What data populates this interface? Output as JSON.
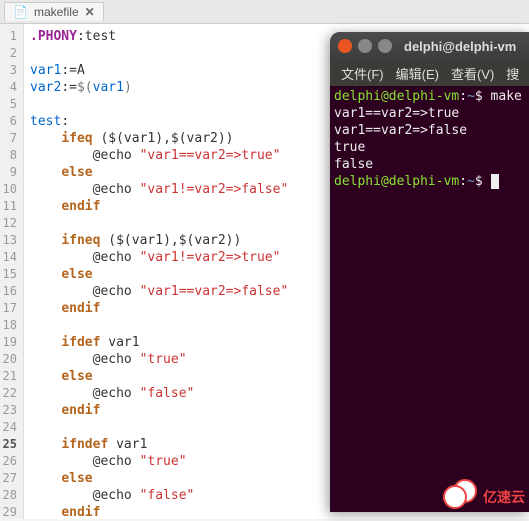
{
  "editor": {
    "tab_name": "makefile",
    "close_glyph": "✕",
    "file_glyph": "📄",
    "lines": [
      {
        "n": "1",
        "segs": [
          {
            "t": ".PHONY",
            "c": "kw-pp"
          },
          {
            "t": ":test"
          }
        ]
      },
      {
        "n": "2",
        "segs": []
      },
      {
        "n": "3",
        "segs": [
          {
            "t": "var1",
            "c": "kw-var"
          },
          {
            "t": ":=A"
          }
        ]
      },
      {
        "n": "4",
        "segs": [
          {
            "t": "var2",
            "c": "kw-var"
          },
          {
            "t": ":="
          },
          {
            "t": "$(",
            "c": "paren"
          },
          {
            "t": "var1",
            "c": "kw-var"
          },
          {
            "t": ")",
            "c": "paren"
          }
        ]
      },
      {
        "n": "5",
        "segs": []
      },
      {
        "n": "6",
        "segs": [
          {
            "t": "test",
            "c": "target"
          },
          {
            "t": ":"
          }
        ]
      },
      {
        "n": "7",
        "segs": [
          {
            "t": "    "
          },
          {
            "t": "ifeq",
            "c": "kw-cond"
          },
          {
            "t": " ($(var1),$(var2))"
          }
        ]
      },
      {
        "n": "8",
        "segs": [
          {
            "t": "        @echo "
          },
          {
            "t": "\"var1==var2=>true\"",
            "c": "str"
          }
        ]
      },
      {
        "n": "9",
        "segs": [
          {
            "t": "    "
          },
          {
            "t": "else",
            "c": "kw-cond"
          }
        ]
      },
      {
        "n": "10",
        "segs": [
          {
            "t": "        @echo "
          },
          {
            "t": "\"var1!=var2=>false\"",
            "c": "str"
          }
        ]
      },
      {
        "n": "11",
        "segs": [
          {
            "t": "    "
          },
          {
            "t": "endif",
            "c": "kw-cond"
          }
        ]
      },
      {
        "n": "12",
        "segs": []
      },
      {
        "n": "13",
        "segs": [
          {
            "t": "    "
          },
          {
            "t": "ifneq",
            "c": "kw-cond"
          },
          {
            "t": " ($(var1),$(var2))"
          }
        ]
      },
      {
        "n": "14",
        "segs": [
          {
            "t": "        @echo "
          },
          {
            "t": "\"var1!=var2=>true\"",
            "c": "str"
          }
        ]
      },
      {
        "n": "15",
        "segs": [
          {
            "t": "    "
          },
          {
            "t": "else",
            "c": "kw-cond"
          }
        ]
      },
      {
        "n": "16",
        "segs": [
          {
            "t": "        @echo "
          },
          {
            "t": "\"var1==var2=>false\"",
            "c": "str"
          }
        ]
      },
      {
        "n": "17",
        "segs": [
          {
            "t": "    "
          },
          {
            "t": "endif",
            "c": "kw-cond"
          }
        ]
      },
      {
        "n": "18",
        "segs": []
      },
      {
        "n": "19",
        "segs": [
          {
            "t": "    "
          },
          {
            "t": "ifdef",
            "c": "kw-cond"
          },
          {
            "t": " var1"
          }
        ]
      },
      {
        "n": "20",
        "segs": [
          {
            "t": "        @echo "
          },
          {
            "t": "\"true\"",
            "c": "str"
          }
        ]
      },
      {
        "n": "21",
        "segs": [
          {
            "t": "    "
          },
          {
            "t": "else",
            "c": "kw-cond"
          }
        ]
      },
      {
        "n": "22",
        "segs": [
          {
            "t": "        @echo "
          },
          {
            "t": "\"false\"",
            "c": "str"
          }
        ]
      },
      {
        "n": "23",
        "segs": [
          {
            "t": "    "
          },
          {
            "t": "endif",
            "c": "kw-cond"
          }
        ]
      },
      {
        "n": "24",
        "segs": []
      },
      {
        "n": "25",
        "bold": true,
        "segs": [
          {
            "t": "    "
          },
          {
            "t": "ifndef",
            "c": "kw-cond"
          },
          {
            "t": " var1"
          }
        ]
      },
      {
        "n": "26",
        "segs": [
          {
            "t": "        @echo "
          },
          {
            "t": "\"true\"",
            "c": "str"
          }
        ]
      },
      {
        "n": "27",
        "segs": [
          {
            "t": "    "
          },
          {
            "t": "else",
            "c": "kw-cond"
          }
        ]
      },
      {
        "n": "28",
        "segs": [
          {
            "t": "        @echo "
          },
          {
            "t": "\"false\"",
            "c": "str"
          }
        ]
      },
      {
        "n": "29",
        "segs": [
          {
            "t": "    "
          },
          {
            "t": "endif",
            "c": "kw-cond"
          }
        ]
      }
    ]
  },
  "terminal": {
    "title": "delphi@delphi-vm",
    "menu": [
      "文件(F)",
      "编辑(E)",
      "查看(V)",
      "搜"
    ],
    "prompt_user": "delphi@delphi-vm",
    "prompt_sep": ":",
    "prompt_path": "~",
    "prompt_end": "$",
    "command": "make",
    "output": [
      "var1==var2=>true",
      "var1==var2=>false",
      "true",
      "false"
    ]
  },
  "watermark": {
    "text": "亿速云"
  }
}
